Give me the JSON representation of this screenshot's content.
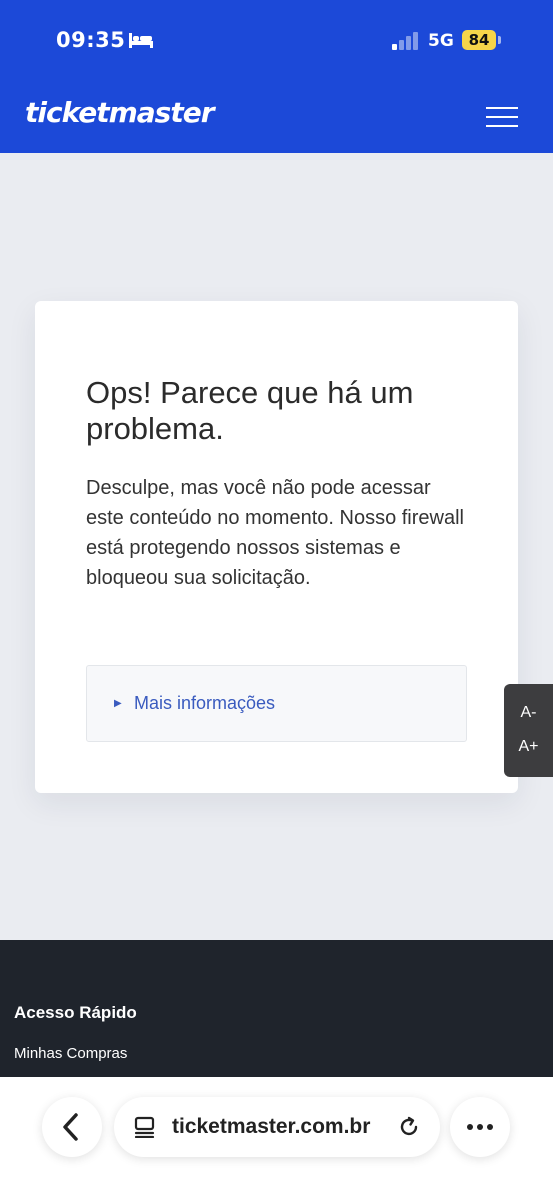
{
  "status_bar": {
    "time": "09:35",
    "network": "5G",
    "battery": "84"
  },
  "header": {
    "logo": "ticketmaster"
  },
  "error_card": {
    "title": "Ops! Parece que há um problema.",
    "body": "Desculpe, mas você não pode acessar este conteúdo no momento. Nosso firewall está protegendo nossos sistemas e bloqueou sua solicitação.",
    "more_info_label": "Mais informações"
  },
  "font_controls": {
    "decrease": "A-",
    "increase": "A+"
  },
  "footer": {
    "heading": "Acesso Rápido",
    "links": [
      "Minhas Compras"
    ]
  },
  "browser_bar": {
    "url": "ticketmaster.com.br"
  },
  "colors": {
    "brand_blue": "#1c49d8",
    "battery_yellow": "#f6d54a",
    "footer_dark": "#1f242c",
    "link_blue": "#3a5bbf"
  }
}
